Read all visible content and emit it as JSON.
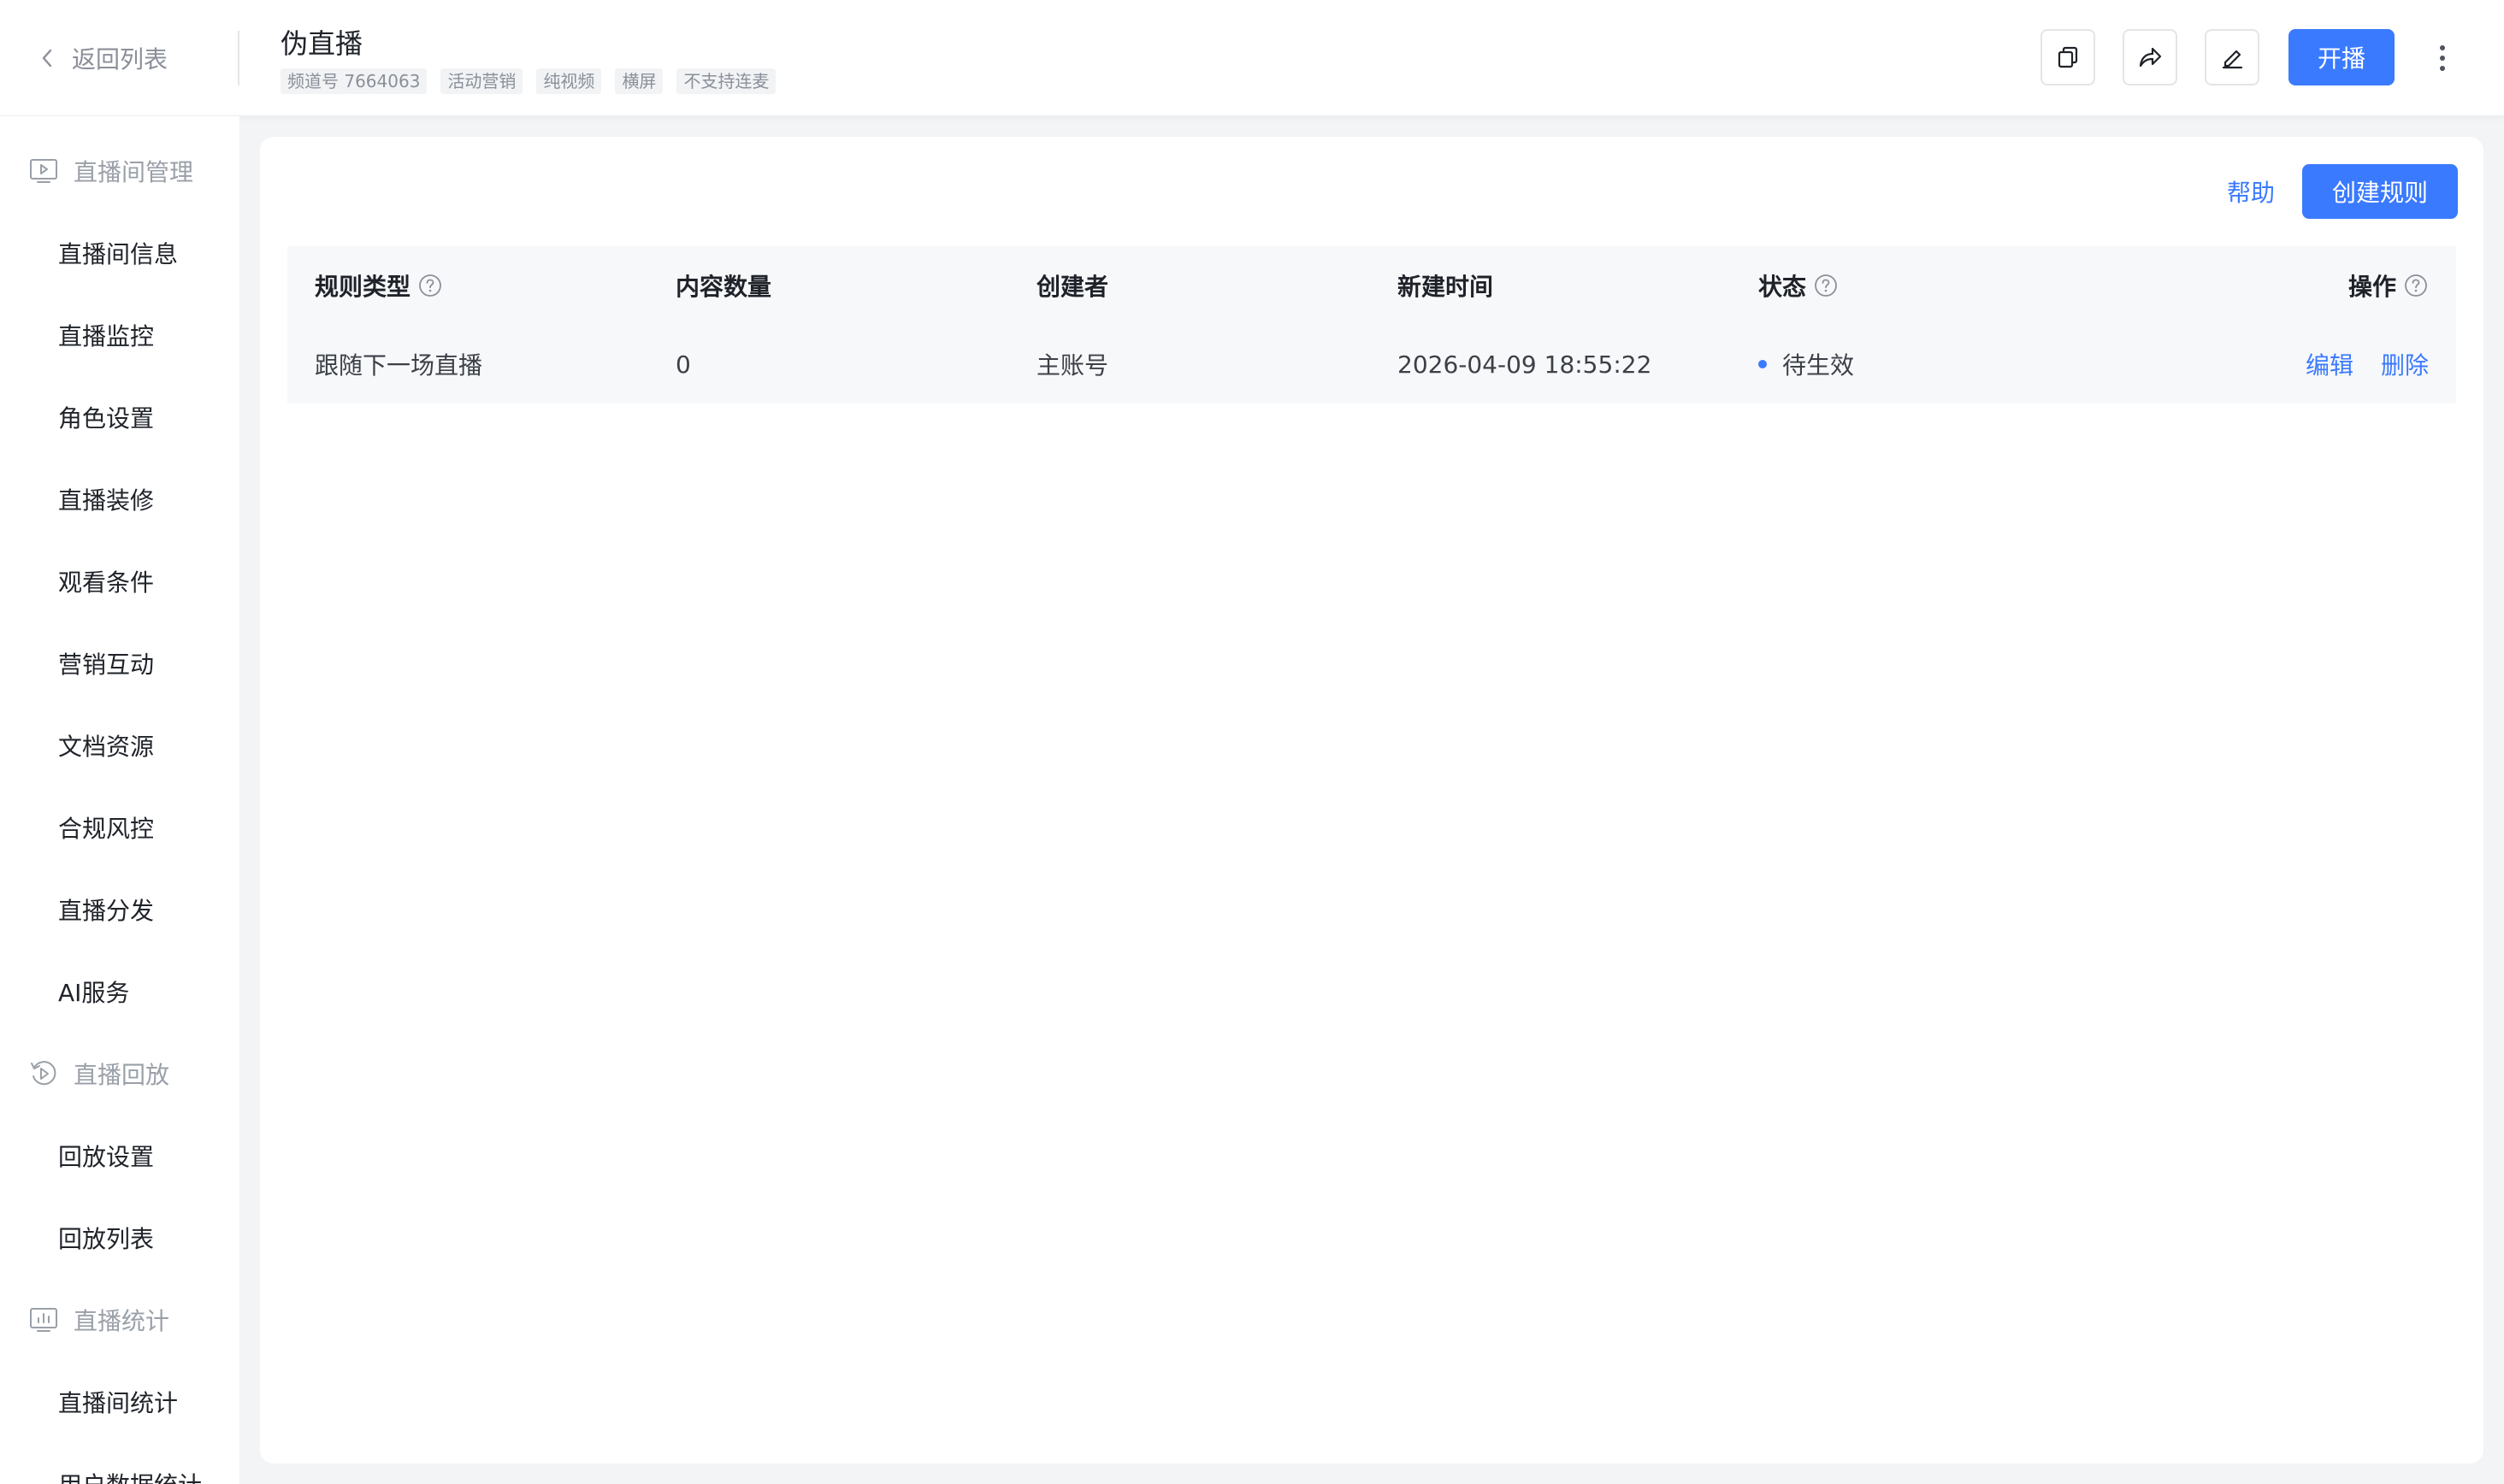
{
  "header": {
    "back_label": "返回列表",
    "title": "伪直播",
    "tags": [
      "频道号 7664063",
      "活动营销",
      "纯视频",
      "横屏",
      "不支持连麦"
    ],
    "live_button": "开播"
  },
  "sidebar": {
    "groups": [
      {
        "label": "直播间管理",
        "icon": "live-room-icon",
        "items": [
          "直播间信息",
          "直播监控",
          "角色设置",
          "直播装修",
          "观看条件",
          "营销互动",
          "文档资源",
          "合规风控",
          "直播分发",
          "AI服务"
        ]
      },
      {
        "label": "直播回放",
        "icon": "playback-icon",
        "items": [
          "回放设置",
          "回放列表"
        ]
      },
      {
        "label": "直播统计",
        "icon": "statistics-icon",
        "items": [
          "直播间统计",
          "用户数据统计"
        ]
      }
    ]
  },
  "main": {
    "help_label": "帮助",
    "create_button": "创建规则",
    "table": {
      "columns": [
        "规则类型",
        "内容数量",
        "创建者",
        "新建时间",
        "状态",
        "操作"
      ],
      "rows": [
        {
          "rule_type": "跟随下一场直播",
          "count": "0",
          "creator": "主账号",
          "created_at": "2026-04-09 18:55:22",
          "status": "待生效",
          "actions": [
            "编辑",
            "删除"
          ]
        }
      ]
    }
  },
  "colors": {
    "primary": "#3a7afe",
    "text": "#1f2329",
    "muted": "#9aa0a8",
    "table_bg": "#f7f8fa"
  }
}
